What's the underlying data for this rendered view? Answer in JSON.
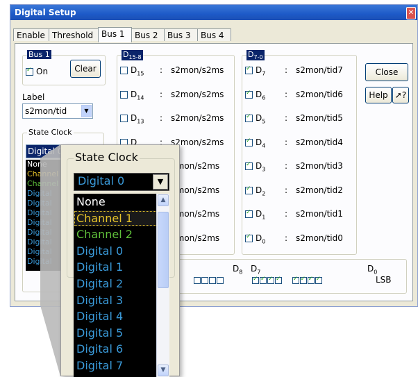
{
  "window": {
    "title": "Digital Setup",
    "close_glyph": "✕"
  },
  "tabs": [
    {
      "label": "Enable"
    },
    {
      "label": "Threshold"
    },
    {
      "label": "Bus 1"
    },
    {
      "label": "Bus 2"
    },
    {
      "label": "Bus 3"
    },
    {
      "label": "Bus 4"
    }
  ],
  "bus": {
    "title": "Bus 1",
    "on_label": "On",
    "clear_label": "Clear"
  },
  "label_field": {
    "label": "Label",
    "value": "s2mon/tid"
  },
  "state_clock": {
    "title": "State Clock",
    "selected": "Digital 0",
    "small_options": [
      "None",
      "Channel 1",
      "Channel 2",
      "Digital",
      "Digital",
      "Digital",
      "Digital",
      "Digital",
      "Digital",
      "Digital",
      "Digital"
    ],
    "options": [
      "None",
      "Channel 1",
      "Channel 2",
      "Digital 0",
      "Digital 1",
      "Digital 2",
      "Digital 3",
      "Digital 4",
      "Digital 5",
      "Digital 6",
      "Digital 7"
    ],
    "highlighted_index": 1,
    "colors": {
      "none": "#ffffff",
      "channel1": "#e6c32a",
      "channel2": "#5fbf3a",
      "digital": "#3a9ad9"
    }
  },
  "high_group": {
    "title": "D15-8",
    "rows": [
      {
        "d": "D",
        "sub": "15",
        "value": "s2mon/s2ms"
      },
      {
        "d": "D",
        "sub": "14",
        "value": "s2mon/s2ms"
      },
      {
        "d": "D",
        "sub": "13",
        "value": "s2mon/s2ms"
      },
      {
        "d": "D",
        "sub": "",
        "value": "s2mon/s2ms"
      },
      {
        "d": "",
        "sub": "",
        "value": "2mon/s2ms"
      },
      {
        "d": "",
        "sub": "",
        "value": "2mon/s2ms"
      },
      {
        "d": "",
        "sub": "",
        "value": "2mon/s2ms"
      },
      {
        "d": "",
        "sub": "",
        "value": "2mon/s2ms"
      }
    ]
  },
  "low_group": {
    "title": "D7-0",
    "rows": [
      {
        "d": "D",
        "sub": "7",
        "value": "s2mon/tid7"
      },
      {
        "d": "D",
        "sub": "6",
        "value": "s2mon/tid6"
      },
      {
        "d": "D",
        "sub": "5",
        "value": "s2mon/tid5"
      },
      {
        "d": "D",
        "sub": "4",
        "value": "s2mon/tid4"
      },
      {
        "d": "D",
        "sub": "3",
        "value": "s2mon/tid3"
      },
      {
        "d": "D",
        "sub": "2",
        "value": "s2mon/tid2"
      },
      {
        "d": "D",
        "sub": "1",
        "value": "s2mon/tid1"
      },
      {
        "d": "D",
        "sub": "0",
        "value": "s2mon/tid0"
      }
    ]
  },
  "separator": ":",
  "bits": {
    "d8": "D",
    "d8_sub": "8",
    "d7": "D",
    "d7_sub": "7",
    "d0": "D",
    "d0_sub": "0",
    "lsb": "LSB"
  },
  "buttons": {
    "close": "Close",
    "help": "Help",
    "whats_this": "?"
  }
}
